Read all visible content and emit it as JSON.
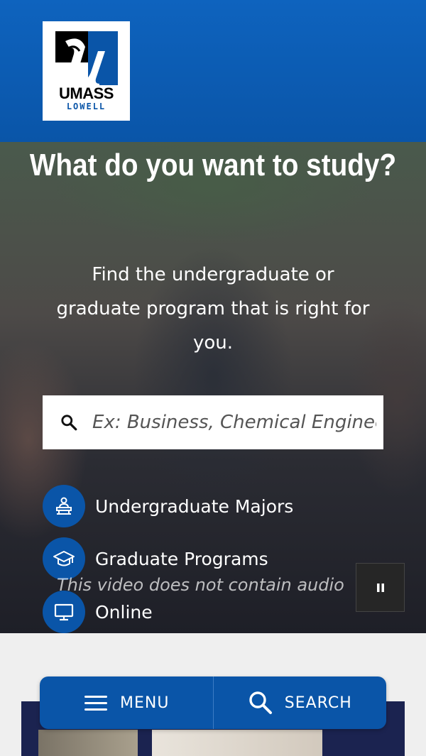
{
  "header": {
    "logo": {
      "alt": "UMass Lowell",
      "word1": "UMASS",
      "word2": "LOWELL",
      "mark_icon": "umass-lowell-u-mark"
    },
    "bg_color": "#0a55a8"
  },
  "hero": {
    "title": "What do you want to study?",
    "subtitle": "Find the undergraduate or graduate program that is right for you.",
    "search": {
      "placeholder": "Ex: Business, Chemical Engineering",
      "value": "",
      "icon": "search-icon"
    },
    "links": [
      {
        "label": "Undergraduate Majors",
        "icon": "student-desk-icon"
      },
      {
        "label": "Graduate Programs",
        "icon": "graduation-cap-icon"
      },
      {
        "label": "Online",
        "icon": "monitor-icon"
      }
    ],
    "audio_note": "This video does not contain audio",
    "pause_icon": "pause-icon"
  },
  "bottom_nav": {
    "menu_label": "MENU",
    "search_label": "SEARCH"
  },
  "colors": {
    "brand_blue": "#0a55a8",
    "card_navy": "#1b2350"
  }
}
